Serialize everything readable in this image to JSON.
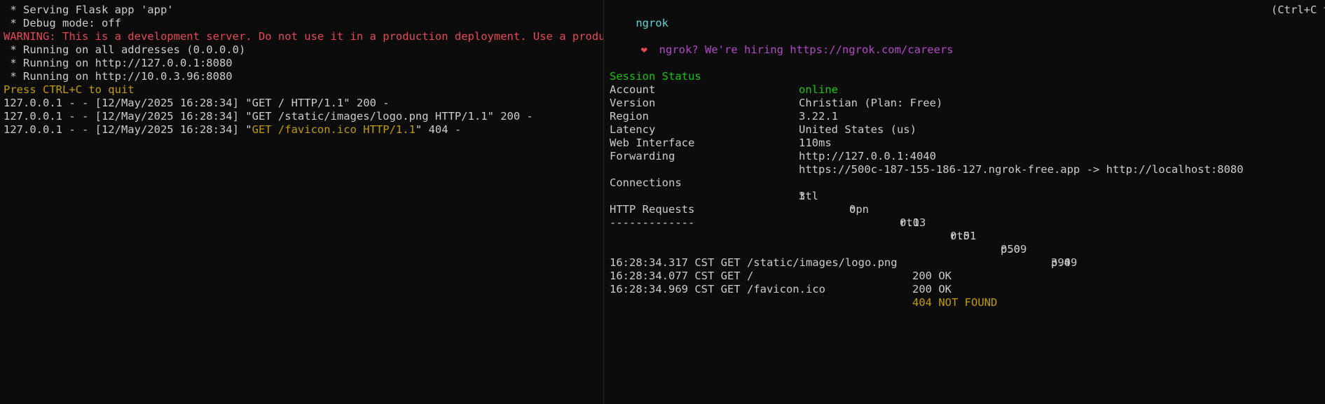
{
  "flask": {
    "lines": [
      {
        "text": " * Serving Flask app 'app'",
        "color": "default"
      },
      {
        "text": " * Debug mode: off",
        "color": "default"
      },
      {
        "text": "WARNING: This is a development server. Do not use it in a production deployment. Use a production WSGI server instead.",
        "color": "red"
      },
      {
        "text": " * Running on all addresses (0.0.0.0)",
        "color": "default"
      },
      {
        "text": " * Running on http://127.0.0.1:8080",
        "color": "default"
      },
      {
        "text": " * Running on http://10.0.3.96:8080",
        "color": "default"
      },
      {
        "text": "Press CTRL+C to quit",
        "color": "yellow"
      }
    ],
    "log": [
      {
        "prefix": "127.0.0.1 - - [12/May/2025 16:28:34] \"",
        "request": "GET / HTTP/1.1",
        "suffix": "\" 200 -",
        "request_color": "default"
      },
      {
        "prefix": "127.0.0.1 - - [12/May/2025 16:28:34] \"",
        "request": "GET /static/images/logo.png HTTP/1.1",
        "suffix": "\" 200 -",
        "request_color": "default"
      },
      {
        "prefix": "127.0.0.1 - - [12/May/2025 16:28:34] \"",
        "request": "GET /favicon.ico HTTP/1.1",
        "suffix": "\" 404 -",
        "request_color": "yellow"
      }
    ]
  },
  "ngrok": {
    "title": "ngrok",
    "quit_hint": "(Ctrl+C to quit)",
    "hiring_icon": "heart-icon",
    "hiring_text": "ngrok? We're hiring https://ngrok.com/careers",
    "status": [
      {
        "key": "Session Status",
        "value": "online",
        "color": "green"
      },
      {
        "key": "Account",
        "value": "Christian (Plan: Free)"
      },
      {
        "key": "Version",
        "value": "3.22.1"
      },
      {
        "key": "Region",
        "value": "United States (us)"
      },
      {
        "key": "Latency",
        "value": "110ms"
      },
      {
        "key": "Web Interface",
        "value": "http://127.0.0.1:4040"
      },
      {
        "key": "Forwarding",
        "value": "https://500c-187-155-186-127.ngrok-free.app -> http://localhost:8080"
      }
    ],
    "connections": {
      "label": "Connections",
      "headers": [
        "ttl",
        "opn",
        "rt1",
        "rt5",
        "p50",
        "p90"
      ],
      "values": [
        "3",
        "0",
        "0.03",
        "0.01",
        "0.09",
        "3.49"
      ]
    },
    "http_requests": {
      "title": "HTTP Requests",
      "underline": "-------------",
      "rows": [
        {
          "time": "16:28:34.317 CST GET /static/images/logo.png",
          "status": "200 OK",
          "color": "default"
        },
        {
          "time": "16:28:34.077 CST GET /",
          "status": "200 OK",
          "color": "default"
        },
        {
          "time": "16:28:34.969 CST GET /favicon.ico",
          "status": "404 NOT FOUND",
          "color": "yellow"
        }
      ]
    }
  },
  "colors": {
    "background": "#0c0c0c",
    "default_text": "#cccccc",
    "red": "#e74856",
    "yellow": "#c19c00",
    "cyan": "#61d6d6",
    "purple": "#b148c6",
    "green": "#16c60c"
  }
}
